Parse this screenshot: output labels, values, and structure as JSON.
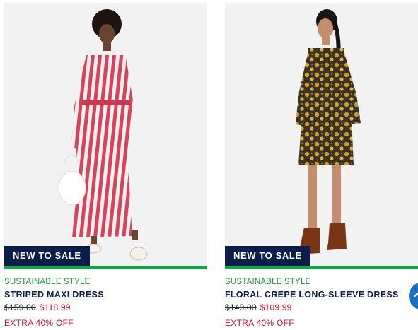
{
  "products": [
    {
      "image_alt": "Striped maxi dress",
      "badge": "NEW TO SALE",
      "tag": "SUSTAINABLE STYLE",
      "name": "STRIPED MAXI DRESS",
      "price_original": "$159.00",
      "price_sale": "$118.99",
      "promo": "EXTRA 40% OFF"
    },
    {
      "image_alt": "Floral crepe long-sleeve dress",
      "badge": "NEW TO SALE",
      "tag": "SUSTAINABLE STYLE",
      "name": "FLORAL CREPE LONG-SLEEVE DRESS",
      "price_original": "$149.00",
      "price_sale": "$109.99",
      "promo": "EXTRA 40% OFF"
    }
  ],
  "colors": {
    "navy": "#0b1d48",
    "sale_red": "#c8102e",
    "sustainable_green": "#23913f",
    "fab_blue": "#1a6fbf"
  },
  "fab": {
    "icon": "chevron-up-icon"
  }
}
